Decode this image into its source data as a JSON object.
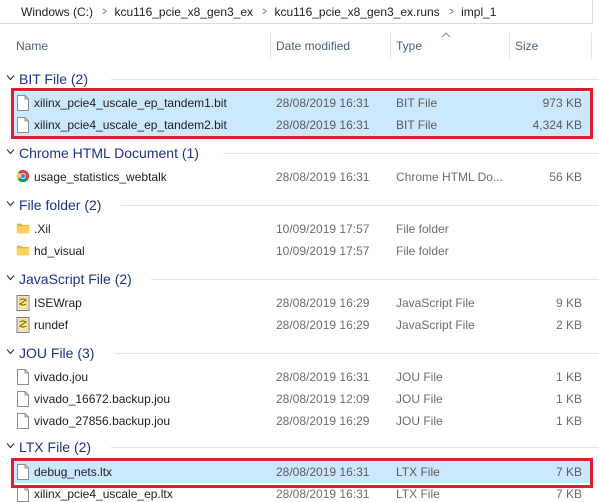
{
  "breadcrumb": [
    "Windows (C:)",
    "kcu116_pcie_x8_gen3_ex",
    "kcu116_pcie_x8_gen3_ex.runs",
    "impl_1"
  ],
  "columns": {
    "name": "Name",
    "date": "Date modified",
    "type": "Type",
    "size": "Size"
  },
  "colors": {
    "group_title": "#1e3287",
    "selection": "#cce8ff",
    "highlight_box": "#e11d2b"
  },
  "groups": [
    {
      "title": "BIT File (2)",
      "files": [
        {
          "name": "xilinx_pcie4_uscale_ep_tandem1.bit",
          "date": "28/08/2019 16:31",
          "type": "BIT File",
          "size": "973 KB",
          "icon": "blank-file-icon",
          "selected": true
        },
        {
          "name": "xilinx_pcie4_uscale_ep_tandem2.bit",
          "date": "28/08/2019 16:31",
          "type": "BIT File",
          "size": "4,324 KB",
          "icon": "blank-file-icon",
          "selected": true
        }
      ]
    },
    {
      "title": "Chrome HTML Document (1)",
      "files": [
        {
          "name": "usage_statistics_webtalk",
          "date": "28/08/2019 16:31",
          "type": "Chrome HTML Do...",
          "size": "56 KB",
          "icon": "chrome-icon",
          "selected": false
        }
      ]
    },
    {
      "title": "File folder (2)",
      "files": [
        {
          "name": ".Xil",
          "date": "10/09/2019 17:57",
          "type": "File folder",
          "size": "",
          "icon": "folder-icon",
          "selected": false
        },
        {
          "name": "hd_visual",
          "date": "10/09/2019 17:57",
          "type": "File folder",
          "size": "",
          "icon": "folder-icon",
          "selected": false
        }
      ]
    },
    {
      "title": "JavaScript File (2)",
      "files": [
        {
          "name": "ISEWrap",
          "date": "28/08/2019 16:29",
          "type": "JavaScript File",
          "size": "9 KB",
          "icon": "script-icon",
          "selected": false
        },
        {
          "name": "rundef",
          "date": "28/08/2019 16:29",
          "type": "JavaScript File",
          "size": "2 KB",
          "icon": "script-icon",
          "selected": false
        }
      ]
    },
    {
      "title": "JOU File (3)",
      "files": [
        {
          "name": "vivado.jou",
          "date": "28/08/2019 16:31",
          "type": "JOU File",
          "size": "1 KB",
          "icon": "blank-file-icon",
          "selected": false
        },
        {
          "name": "vivado_16672.backup.jou",
          "date": "28/08/2019 12:09",
          "type": "JOU File",
          "size": "1 KB",
          "icon": "blank-file-icon",
          "selected": false
        },
        {
          "name": "vivado_27856.backup.jou",
          "date": "28/08/2019 16:29",
          "type": "JOU File",
          "size": "1 KB",
          "icon": "blank-file-icon",
          "selected": false
        }
      ]
    },
    {
      "title": "LTX File (2)",
      "files": [
        {
          "name": "debug_nets.ltx",
          "date": "28/08/2019 16:31",
          "type": "LTX File",
          "size": "7 KB",
          "icon": "blank-file-icon",
          "selected": true
        },
        {
          "name": "xilinx_pcie4_uscale_ep.ltx",
          "date": "28/08/2019 16:31",
          "type": "LTX File",
          "size": "7 KB",
          "icon": "blank-file-icon",
          "selected": false
        }
      ]
    }
  ]
}
